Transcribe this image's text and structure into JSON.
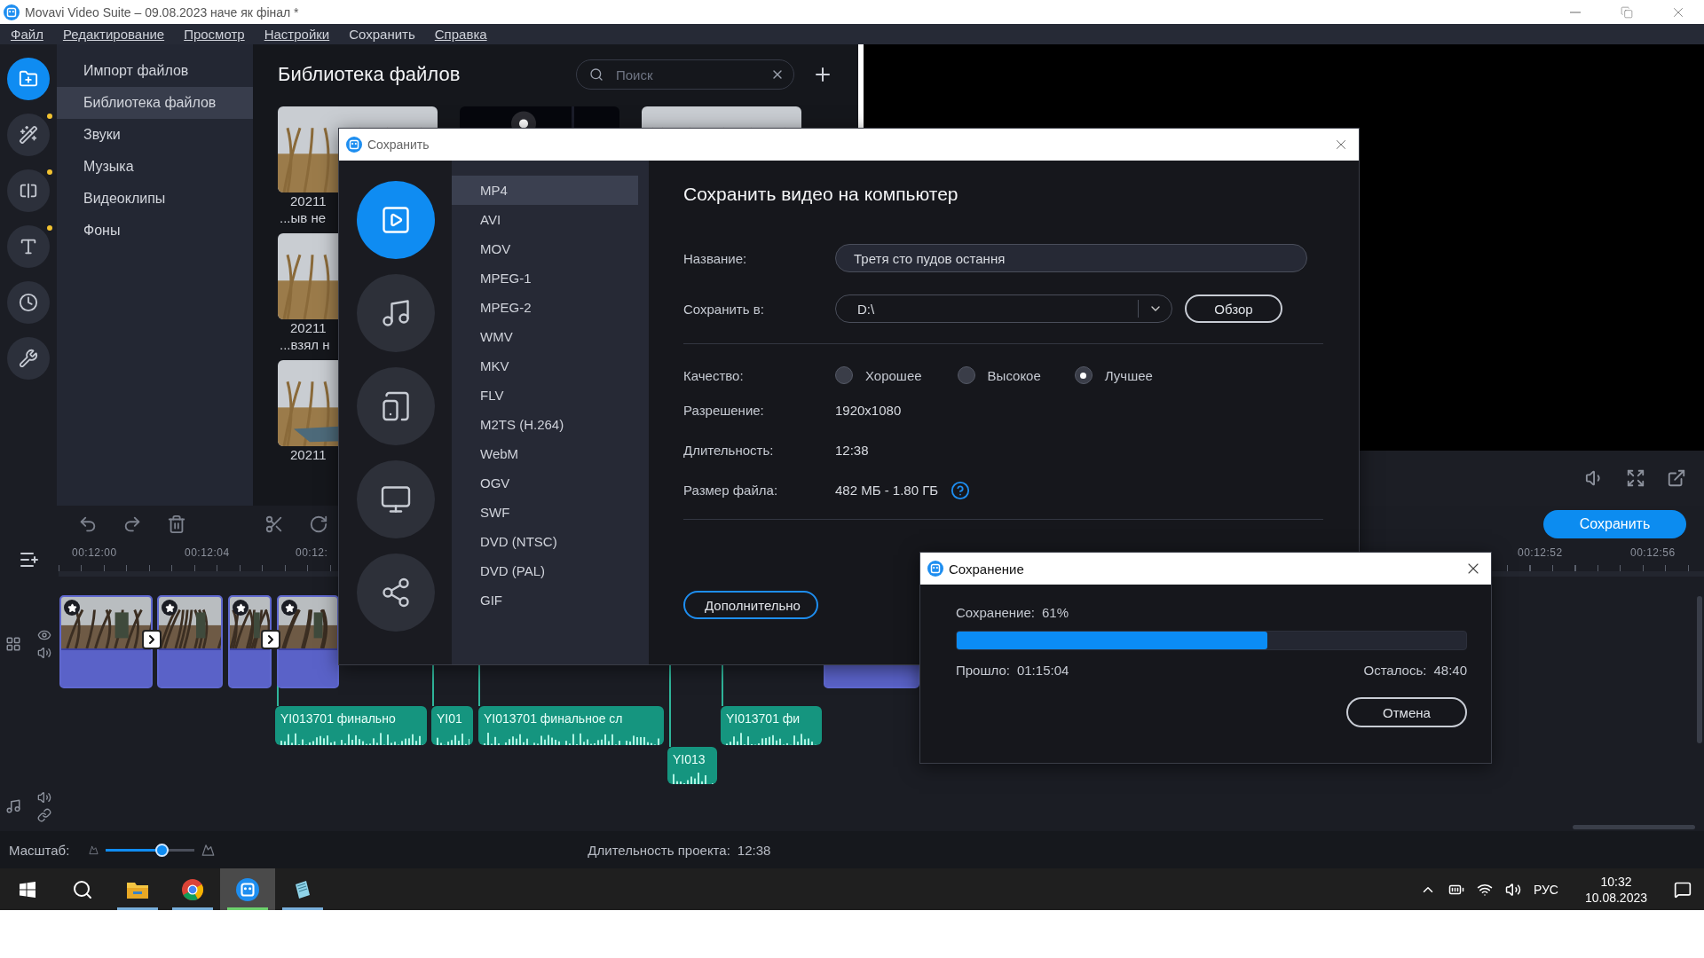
{
  "window": {
    "title": "Movavi Video Suite – 09.08.2023 наче як фінал *"
  },
  "menu": [
    {
      "label": "Файл",
      "underlined": true
    },
    {
      "label": "Редактирование",
      "underlined": true
    },
    {
      "label": "Просмотр",
      "underlined": true
    },
    {
      "label": "Настройки",
      "underlined": true
    },
    {
      "label": "Сохранить",
      "underlined": false
    },
    {
      "label": "Справка",
      "underlined": true
    }
  ],
  "rail": [
    {
      "kind": "import",
      "selected": true,
      "notify": false
    },
    {
      "kind": "effects",
      "selected": false,
      "notify": true
    },
    {
      "kind": "transitions",
      "selected": false,
      "notify": true
    },
    {
      "kind": "titles",
      "selected": false,
      "notify": true
    },
    {
      "kind": "stickers",
      "selected": false,
      "notify": false
    },
    {
      "kind": "tools",
      "selected": false,
      "notify": false
    }
  ],
  "sidebar": {
    "items": [
      {
        "label": "Импорт файлов",
        "selected": false
      },
      {
        "label": "Библиотека файлов",
        "selected": true
      },
      {
        "label": "Звуки",
        "selected": false
      },
      {
        "label": "Музыка",
        "selected": false
      },
      {
        "label": "Видеоклипы",
        "selected": false
      },
      {
        "label": "Фоны",
        "selected": false
      }
    ]
  },
  "library": {
    "title": "Библиотека файлов",
    "search": {
      "placeholder": "Поиск"
    },
    "columns": [
      {
        "items": [
          {
            "kind": "reeds",
            "caption": [
              "20211",
              "...ыв не"
            ]
          },
          {
            "kind": "reeds",
            "caption": [
              "20211",
              "...взял н"
            ]
          },
          {
            "kind": "boat",
            "caption": [
              "20211"
            ]
          }
        ]
      },
      {
        "items": [
          {
            "kind": "night"
          }
        ]
      },
      {
        "items": [
          {
            "kind": "reeds"
          }
        ]
      }
    ]
  },
  "preview": {
    "save_button": "Сохранить"
  },
  "timeline": {
    "ruler": [
      "00:12:00",
      "00:12:04",
      "00:12:"
    ],
    "ruler_right": [
      "00:12:52",
      "00:12:56"
    ],
    "video_clips": [
      {
        "transition": true
      },
      {
        "transition": false
      },
      {
        "transition": true
      },
      {
        "transition": false
      }
    ],
    "audio_clips": [
      {
        "label": "YI013701 финально"
      },
      {
        "label": "YI01"
      },
      {
        "label": "YI013701 финальное сл"
      },
      {
        "label": "YI013701 фи"
      },
      {
        "label": "YI013"
      }
    ]
  },
  "save_dialog": {
    "title": "Сохранить",
    "categories": [
      {
        "kind": "video",
        "selected": true
      },
      {
        "kind": "audio",
        "selected": false
      },
      {
        "kind": "devices",
        "selected": false
      },
      {
        "kind": "tv",
        "selected": false
      },
      {
        "kind": "share",
        "selected": false
      }
    ],
    "formats": [
      {
        "label": "MP4",
        "selected": true
      },
      {
        "label": "AVI",
        "selected": false
      },
      {
        "label": "MOV",
        "selected": false
      },
      {
        "label": "MPEG-1",
        "selected": false
      },
      {
        "label": "MPEG-2",
        "selected": false
      },
      {
        "label": "WMV",
        "selected": false
      },
      {
        "label": "MKV",
        "selected": false
      },
      {
        "label": "FLV",
        "selected": false
      },
      {
        "label": "M2TS (H.264)",
        "selected": false
      },
      {
        "label": "WebM",
        "selected": false
      },
      {
        "label": "OGV",
        "selected": false
      },
      {
        "label": "SWF",
        "selected": false
      },
      {
        "label": "DVD (NTSC)",
        "selected": false
      },
      {
        "label": "DVD (PAL)",
        "selected": false
      },
      {
        "label": "GIF",
        "selected": false
      }
    ],
    "heading": "Сохранить видео на компьютер",
    "name": {
      "label": "Название:",
      "value": "Третя сто пудов остання"
    },
    "folder": {
      "label": "Сохранить в:",
      "value": "D:\\",
      "button": "Обзор"
    },
    "quality": {
      "label": "Качество:",
      "options": [
        {
          "label": "Хорошее",
          "selected": false
        },
        {
          "label": "Высокое",
          "selected": false
        },
        {
          "label": "Лучшее",
          "selected": true
        }
      ]
    },
    "info": [
      {
        "label": "Разрешение:",
        "value": "1920x1080",
        "help": false
      },
      {
        "label": "Длительность:",
        "value": "12:38",
        "help": false
      },
      {
        "label": "Размер файла:",
        "value": "482 МБ - 1.80 ГБ",
        "help": true
      }
    ],
    "more_button": "Дополнительно"
  },
  "progress_dialog": {
    "title": "Сохранение",
    "label": "Сохранение:",
    "percent": "61%",
    "level": 0.61,
    "elapsed_label": "Прошло:",
    "elapsed": "01:15:04",
    "remaining_label": "Осталось:",
    "remaining": "48:40",
    "cancel": "Отмена"
  },
  "status_bar": {
    "zoom_label": "Масштаб:",
    "zoom": {
      "level": 0.65
    },
    "duration_label": "Длительность проекта:",
    "duration": "12:38"
  },
  "taskbar": {
    "apps": [
      {
        "kind": "start",
        "running": false,
        "selected": false
      },
      {
        "kind": "search",
        "running": false,
        "selected": false
      },
      {
        "kind": "explorer",
        "running": true,
        "selected": false
      },
      {
        "kind": "chrome",
        "running": true,
        "selected": false
      },
      {
        "kind": "movavi",
        "running": true,
        "selected": true
      },
      {
        "kind": "notes",
        "running": true,
        "selected": false
      }
    ],
    "language": "РУС",
    "time": "10:32",
    "date": "10.08.2023"
  }
}
